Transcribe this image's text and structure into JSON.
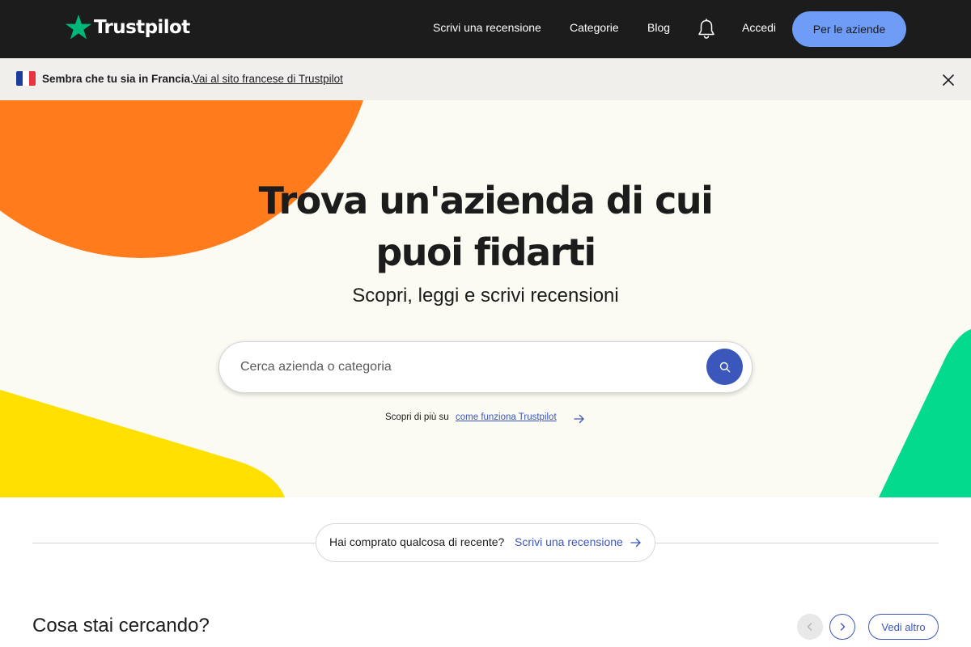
{
  "brand": {
    "name": "Trustpilot",
    "star_color": "#00b67a"
  },
  "nav": {
    "write_review": "Scrivi una recensione",
    "categories": "Categorie",
    "blog": "Blog",
    "notifications_icon": "bell-icon",
    "login": "Accedi",
    "business_button": "Per le aziende"
  },
  "banner": {
    "country_flag": "france-flag-icon",
    "message": "Sembra che tu sia in Francia.",
    "link": "Vai al sito francese di Trustpilot",
    "close_icon": "close-icon"
  },
  "hero": {
    "title_line1": "Trova un'azienda di cui",
    "title_line2": "puoi fidarti",
    "subtitle": "Scopri, leggi e scrivi recensioni",
    "search": {
      "value": "",
      "placeholder": "Cerca azienda o categoria",
      "icon": "search-icon"
    },
    "learn_more_prefix": "Scopri di più su",
    "learn_more_link": "come funziona Trustpilot",
    "colors": {
      "background": "#fcfbf3",
      "orange": "#ff7b1c",
      "yellow": "#ffe000",
      "green": "#04da8d"
    }
  },
  "review_prompt": {
    "text": "Hai comprato qualcosa di recente?",
    "link": "Scrivi una recensione"
  },
  "categories_section": {
    "title": "Cosa stai cercando?",
    "see_more": "Vedi altro",
    "prev_icon": "chevron-left-icon",
    "next_icon": "chevron-right-icon"
  },
  "colors": {
    "header_bg": "#1c1c1c",
    "accent_blue": "#3c57bc",
    "business_button_bg": "#6e9cf7",
    "banner_bg": "#f1efec"
  }
}
